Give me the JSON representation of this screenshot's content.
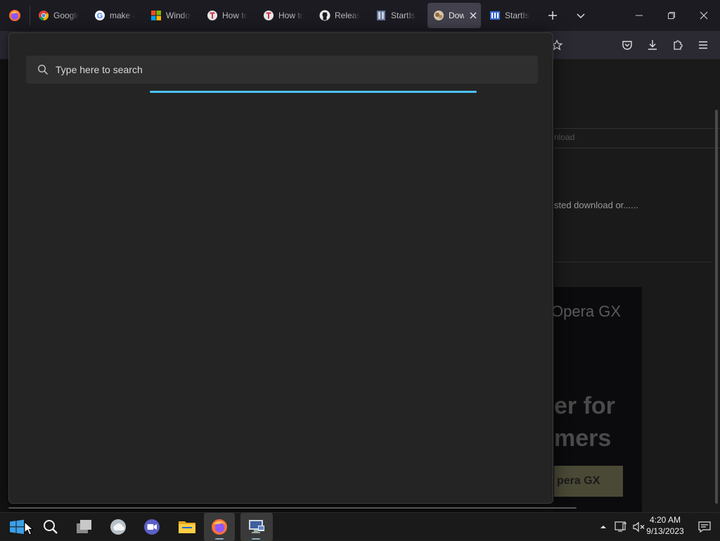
{
  "browser": {
    "tabs": [
      {
        "label": "Google",
        "icon": "chrome-icon"
      },
      {
        "label": "make a",
        "icon": "google-icon"
      },
      {
        "label": "Windows",
        "icon": "microsoft-icon"
      },
      {
        "label": "How to",
        "icon": "howto-icon"
      },
      {
        "label": "How to",
        "icon": "howto-icon"
      },
      {
        "label": "Releases",
        "icon": "github-icon"
      },
      {
        "label": "StartIsB",
        "icon": "startisback-icon"
      },
      {
        "label": "Dow",
        "icon": "download-site-icon",
        "active": true
      },
      {
        "label": "StartIsB",
        "icon": "startisback-icon"
      }
    ],
    "page_fragments": {
      "download_link": "nload",
      "suggested_text": "sted download or......",
      "ad_brand": "Opera GX",
      "ad_headline_1": "er for",
      "ad_headline_2": "mers",
      "ad_button": "pera GX"
    }
  },
  "start_menu": {
    "search": {
      "placeholder": "Type here to search",
      "value": ""
    }
  },
  "taskbar": {
    "clock_time": "4:20 AM",
    "clock_date": "9/13/2023"
  },
  "colors": {
    "accent": "#4cc2ff",
    "start_bg": "#242424",
    "tabbar": "#1c1b22"
  }
}
